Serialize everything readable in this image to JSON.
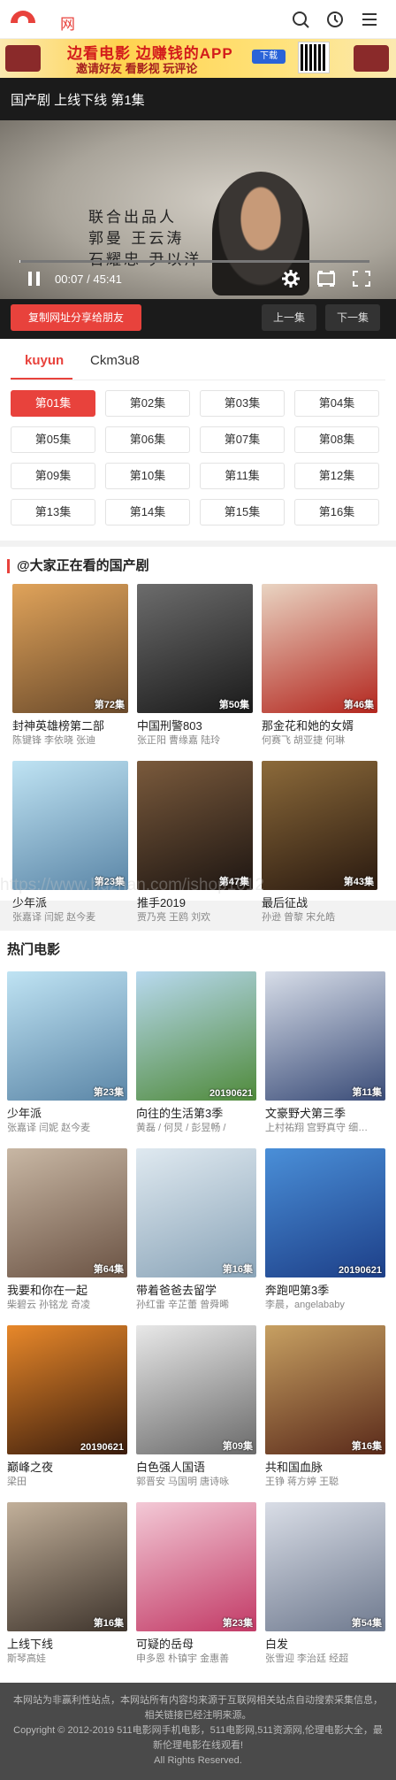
{
  "header": {
    "logo_text": "网",
    "icons": [
      "search-icon",
      "history-icon",
      "menu-icon"
    ]
  },
  "banner": {
    "line1": "边看电影 边赚钱的APP",
    "line2": "邀请好友 看影视 玩评论",
    "download": "下载"
  },
  "player": {
    "title": "国产剧  上线下线  第1集",
    "video_text": [
      "联合出品人",
      "郭曼  王云涛",
      "石耀忠  尹以洋"
    ],
    "time": "00:07 / 45:41",
    "progress": 0.003
  },
  "actions": {
    "share": "复制网址分享给朋友",
    "prev": "上一集",
    "next": "下一集"
  },
  "sources": [
    "kuyun",
    "Ckm3u8"
  ],
  "episodes": [
    "第01集",
    "第02集",
    "第03集",
    "第04集",
    "第05集",
    "第06集",
    "第07集",
    "第08集",
    "第09集",
    "第10集",
    "第11集",
    "第12集",
    "第13集",
    "第14集",
    "第15集",
    "第16集"
  ],
  "current_episode": 0,
  "section1": {
    "title": "@大家正在看的国产剧",
    "items": [
      {
        "name": "封神英雄榜第二部",
        "stars": "陈键锋 李依晓 张迪",
        "badge": "第72集",
        "c1": "#e0a35a",
        "c2": "#6a4a2b"
      },
      {
        "name": "中国刑警803",
        "stars": "张正阳 曹缘嘉 陆玲",
        "badge": "第50集",
        "c1": "#6c6c6c",
        "c2": "#1a1a1a"
      },
      {
        "name": "那金花和她的女婿",
        "stars": "何赛飞 胡亚捷 何琳",
        "badge": "第46集",
        "c1": "#e9d4c2",
        "c2": "#b3261e"
      },
      {
        "name": "少年派",
        "stars": "张嘉译 闫妮 赵今麦",
        "badge": "第23集",
        "c1": "#bfe3f3",
        "c2": "#5b86a7"
      },
      {
        "name": "推手2019",
        "stars": "贾乃亮 王鸥 刘欢",
        "badge": "第47集",
        "c1": "#7a5a3c",
        "c2": "#1e1612"
      },
      {
        "name": "最后征战",
        "stars": "孙逊 曾黎 宋允皓",
        "badge": "第43集",
        "c1": "#8c6a3a",
        "c2": "#2a1a10"
      }
    ]
  },
  "section2": {
    "title": "热门电影",
    "items": [
      {
        "name": "少年派",
        "stars": "张嘉译 闫妮 赵今麦",
        "badge": "第23集",
        "c1": "#bfe3f3",
        "c2": "#5b86a7"
      },
      {
        "name": "向往的生活第3季",
        "stars": "黄磊 / 何炅 / 彭昱畅 /",
        "badge": "20190621",
        "c1": "#b8d9ef",
        "c2": "#4f8a3a"
      },
      {
        "name": "文豪野犬第三季",
        "stars": "上村祐翔 宫野真守 细…",
        "badge": "第11集",
        "c1": "#d7dde8",
        "c2": "#3a4c78"
      },
      {
        "name": "我要和你在一起",
        "stars": "柴碧云 孙铭龙 奇凌",
        "badge": "第64集",
        "c1": "#c8b7a4",
        "c2": "#6b5344"
      },
      {
        "name": "带着爸爸去留学",
        "stars": "孙红雷 辛芷蕾 曾舜晞",
        "badge": "第16集",
        "c1": "#dfe9f0",
        "c2": "#8aa4b8"
      },
      {
        "name": "奔跑吧第3季",
        "stars": "李晨，angelababy",
        "badge": "20190621",
        "c1": "#4a8fd8",
        "c2": "#1d3f88"
      },
      {
        "name": "巅峰之夜",
        "stars": "梁田",
        "badge": "20190621",
        "c1": "#e8882a",
        "c2": "#3a1c0c"
      },
      {
        "name": "白色强人国语",
        "stars": "郭晋安 马国明 唐诗咏",
        "badge": "第09集",
        "c1": "#e8e8e8",
        "c2": "#6a6a6a"
      },
      {
        "name": "共和国血脉",
        "stars": "王铮 蒋方婷 王聪",
        "badge": "第16集",
        "c1": "#c7a062",
        "c2": "#5a2a1a"
      },
      {
        "name": "上线下线",
        "stars": "斯琴高娃",
        "badge": "第16集",
        "c1": "#c2b09a",
        "c2": "#3e342c"
      },
      {
        "name": "可疑的岳母",
        "stars": "申多恩 朴镇宇 金惠善",
        "badge": "第23集",
        "c1": "#f3c9d6",
        "c2": "#c23a66"
      },
      {
        "name": "白发",
        "stars": "张雪迎 李治廷 经超",
        "badge": "第54集",
        "c1": "#d9dde6",
        "c2": "#6f7a8f"
      }
    ]
  },
  "watermark": "https://www.huzhan.com/ishop1012",
  "footer": {
    "line1": "本网站为非赢利性站点，本网站所有内容均来源于互联网相关站点自动搜索采集信息，相关链接已经注明来源。",
    "line2": "Copyright © 2012-2019 511电影网手机电影，511电影网,511资源网,伦理电影大全，最新伦理电影在线观看!",
    "line3": "All Rights Reserved."
  }
}
